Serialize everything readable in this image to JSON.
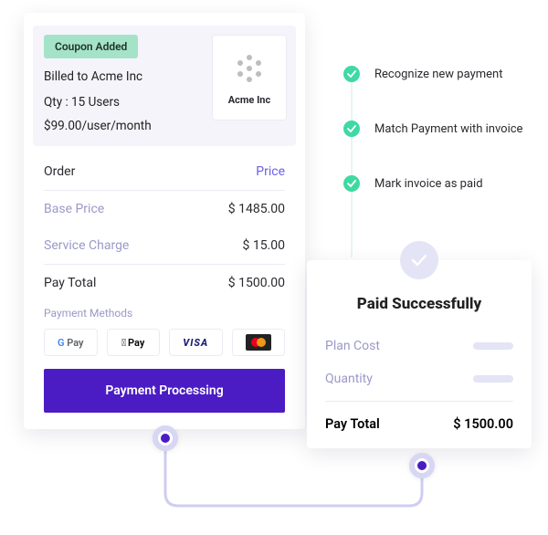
{
  "checkout": {
    "coupon_label": "Coupon Added",
    "billed_to": "Billed to Acme Inc",
    "qty": "Qty : 15 Users",
    "rate": "$99.00/user/month",
    "company_name": "Acme Inc",
    "order_header_left": "Order",
    "order_header_right": "Price",
    "lines": [
      {
        "label": "Base Price",
        "amount": "$ 1485.00"
      },
      {
        "label": "Service Charge",
        "amount": "$ 15.00"
      }
    ],
    "total_label": "Pay Total",
    "total_amount": "$ 1500.00",
    "payment_methods_label": "Payment Methods",
    "methods": {
      "gpay": "G Pay",
      "applepay": "Pay",
      "visa": "VISA"
    },
    "button_label": "Payment Processing"
  },
  "timeline": [
    "Recognize new payment",
    "Match Payment with invoice",
    "Mark invoice as paid"
  ],
  "success": {
    "title": "Paid Successfully",
    "rows": [
      {
        "label": "Plan Cost"
      },
      {
        "label": "Quantity"
      }
    ],
    "total_label": "Pay Total",
    "total_amount": "$ 1500.00"
  }
}
